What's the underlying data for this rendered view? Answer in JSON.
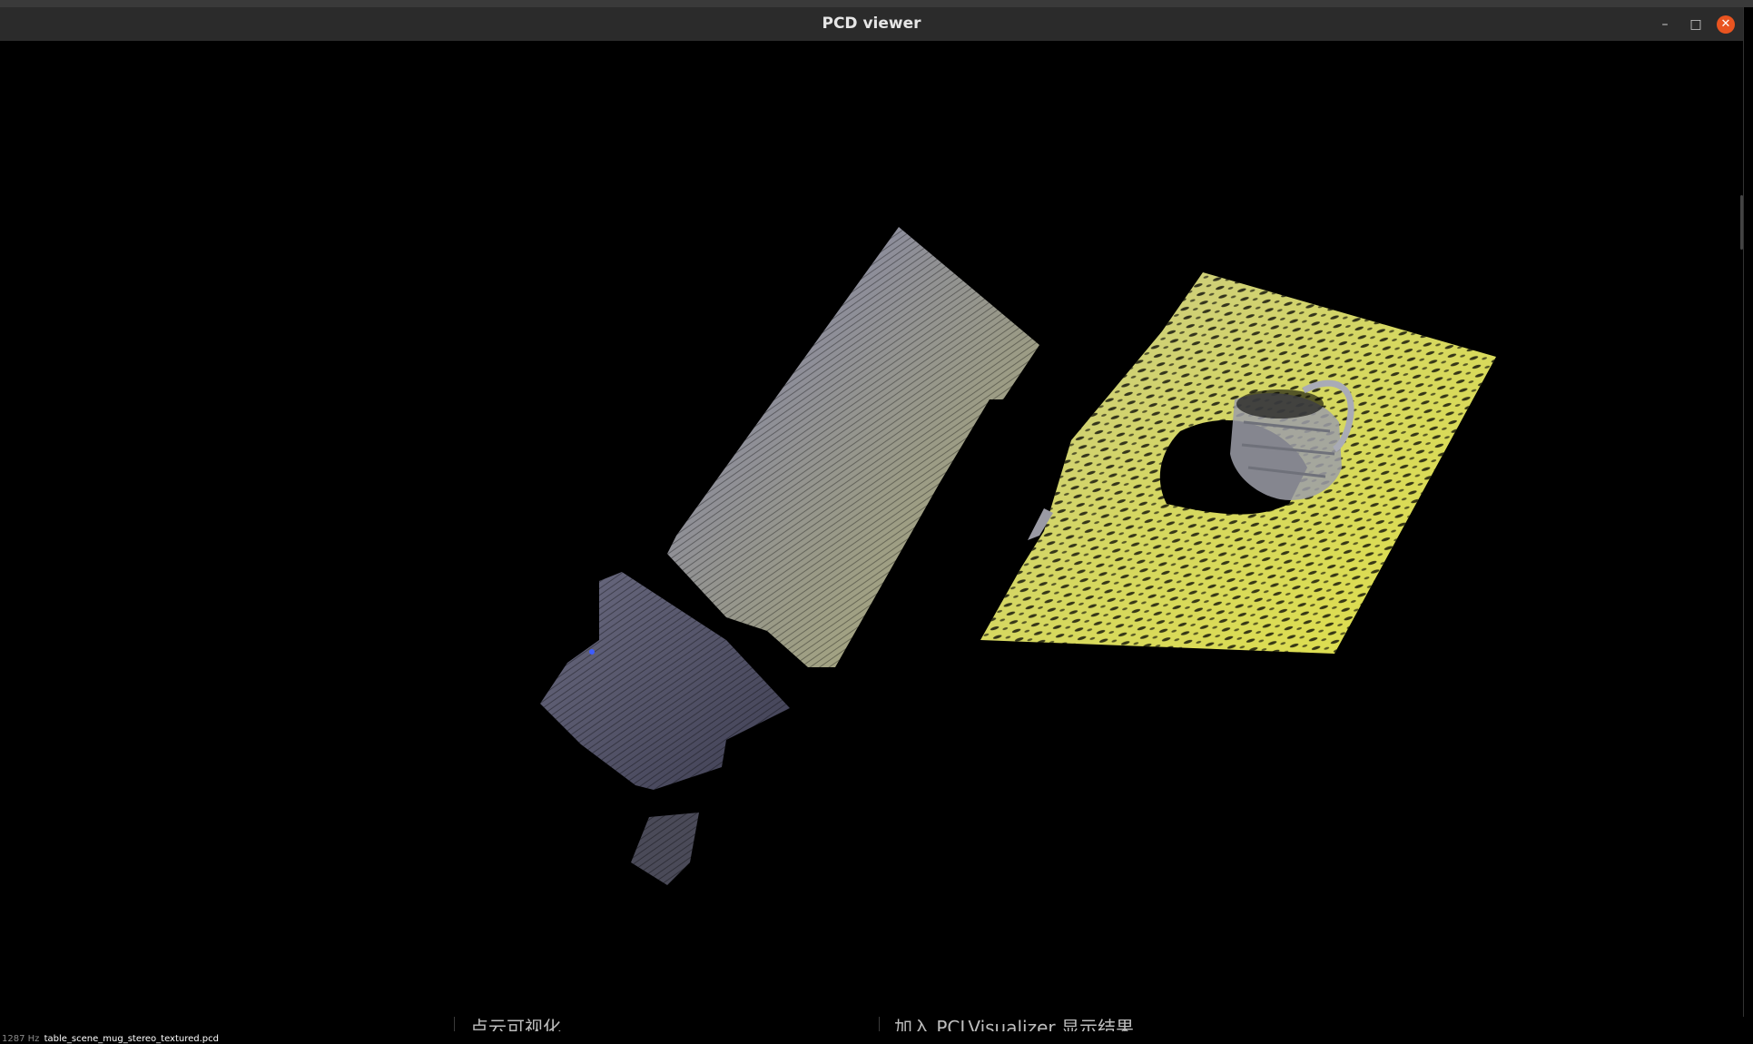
{
  "window": {
    "title": "PCD viewer",
    "controls": {
      "minimize": "–",
      "maximize": "□",
      "close": "✕"
    },
    "accent_close": "#e95420"
  },
  "viewport": {
    "background": "#000000",
    "status_fps": "1287 Hz",
    "status_file": "table_scene_mug_stereo_textured.pcd"
  },
  "background_window": {
    "left_text": "点云可视化",
    "right_text": "加入 PCLVisualizer 显示结果"
  }
}
